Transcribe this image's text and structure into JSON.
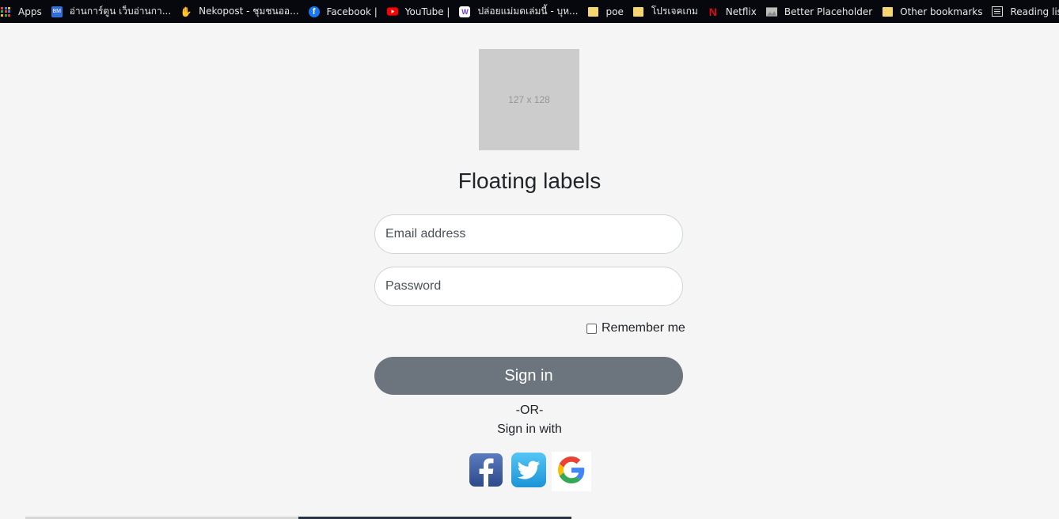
{
  "bookmarks": {
    "items": [
      {
        "label": "Apps",
        "icon": "apps-grid-icon"
      },
      {
        "label": "อ่านการ์ตูน เว็บอ่านกา...",
        "icon": "manga-site-icon"
      },
      {
        "label": "Nekopost - ชุมชนออ...",
        "icon": "nekopost-icon"
      },
      {
        "label": "Facebook |",
        "icon": "facebook-icon"
      },
      {
        "label": "YouTube |",
        "icon": "youtube-icon"
      },
      {
        "label": "ปล่อยแม่มดเล่มนี้ - บุห...",
        "icon": "site-icon"
      },
      {
        "label": "poe",
        "icon": "folder-icon"
      },
      {
        "label": "โปรเจคเกม",
        "icon": "folder-icon"
      },
      {
        "label": "Netflix",
        "icon": "netflix-icon"
      },
      {
        "label": "Better Placeholder",
        "icon": "image-icon"
      }
    ],
    "other": {
      "label": "Other bookmarks",
      "icon": "folder-icon"
    },
    "reading_list": {
      "label": "Reading list",
      "icon": "reading-list-icon"
    }
  },
  "logo_placeholder": "127 x 128",
  "title": "Floating labels",
  "form": {
    "email_placeholder": "Email address",
    "password_placeholder": "Password",
    "remember_label": "Remember me",
    "submit_label": "Sign in"
  },
  "or_text": "-OR-",
  "sign_in_with": "Sign in with",
  "social": [
    {
      "name": "facebook",
      "color": "#3b5998"
    },
    {
      "name": "twitter",
      "color": "#1da1f2"
    },
    {
      "name": "google",
      "color": "#4285f4"
    }
  ]
}
